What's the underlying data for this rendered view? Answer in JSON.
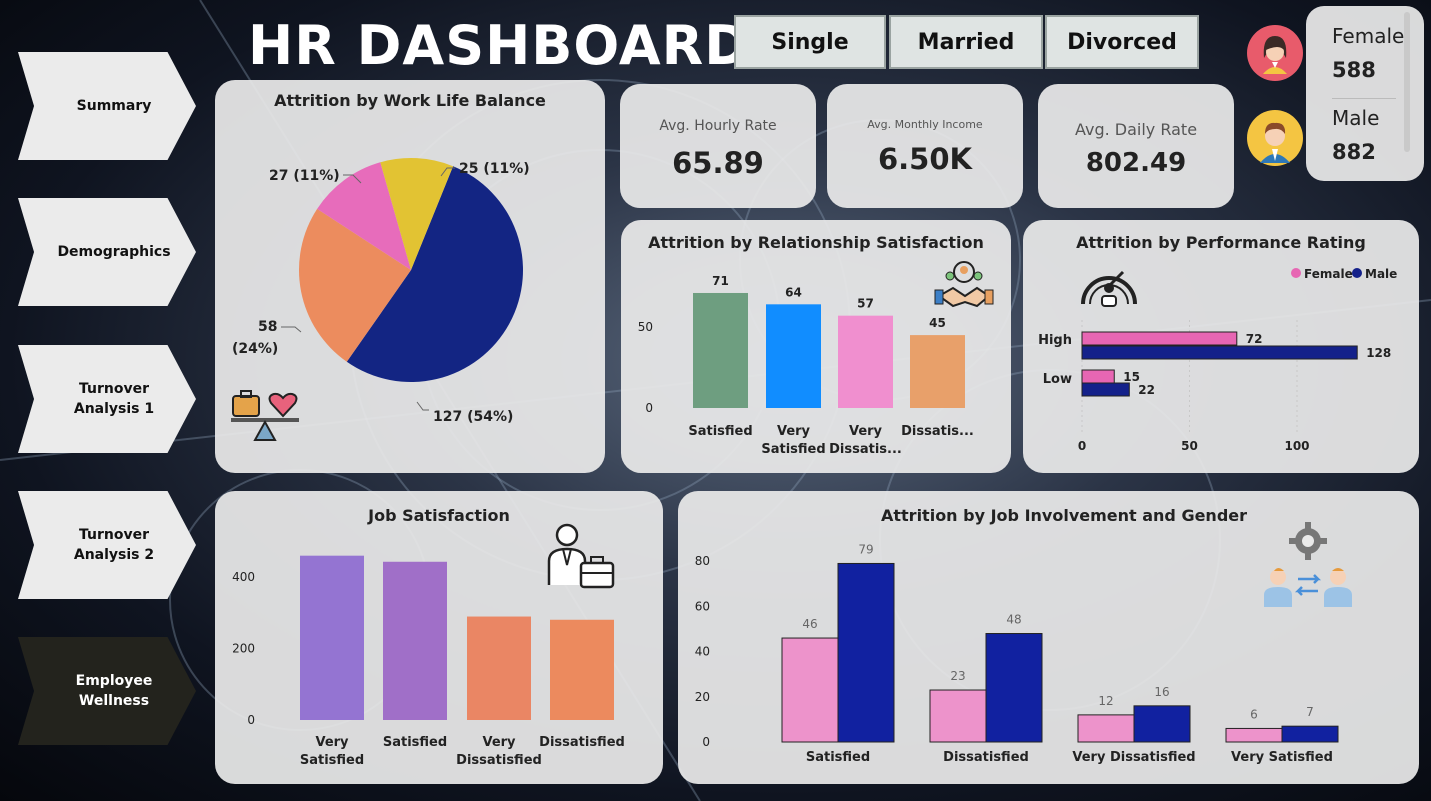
{
  "title": "HR DASHBOARD",
  "nav": [
    {
      "label": "Summary"
    },
    {
      "label": "Demographics"
    },
    {
      "label": "Turnover Analysis 1"
    },
    {
      "label": "Turnover Analysis 2"
    },
    {
      "label": "Employee Wellness"
    }
  ],
  "slicers": [
    "Single",
    "Married",
    "Divorced"
  ],
  "gender": {
    "female_label": "Female",
    "female_value": "588",
    "male_label": "Male",
    "male_value": "882"
  },
  "kpis": {
    "hourly": {
      "label": "Avg. Hourly Rate",
      "value": "65.89"
    },
    "monthly": {
      "label": "Avg. Monthly Income",
      "value": "6.50K"
    },
    "daily": {
      "label": "Avg. Daily Rate",
      "value": "802.49"
    }
  },
  "chart_data": [
    {
      "id": "work_life",
      "type": "pie",
      "title": "Attrition by Work Life Balance",
      "values": [
        127,
        58,
        27,
        25
      ],
      "labels": [
        "127 (54%)",
        "58 (24%)",
        "27 (11%)",
        "25 (11%)"
      ],
      "colors": [
        "#132583",
        "#ec8c5e",
        "#e76cbb",
        "#e2c333"
      ]
    },
    {
      "id": "relationship",
      "type": "bar",
      "title": "Attrition by Relationship Satisfaction",
      "categories": [
        "Satisfied",
        "Very Satisfied",
        "Very Dissatis...",
        "Dissatis..."
      ],
      "values": [
        71,
        64,
        57,
        45
      ],
      "colors": [
        "#6e9e80",
        "#118dff",
        "#f08fcf",
        "#e8a06a"
      ],
      "yticks": [
        0,
        50
      ],
      "ylim": [
        0,
        80
      ]
    },
    {
      "id": "performance",
      "type": "bar",
      "orientation": "horizontal",
      "title": "Attrition by Performance Rating",
      "categories": [
        "High",
        "Low"
      ],
      "series": [
        {
          "name": "Female",
          "values": [
            72,
            15
          ],
          "color": "#e766b3"
        },
        {
          "name": "Male",
          "values": [
            128,
            22
          ],
          "color": "#14218a"
        }
      ],
      "xticks": [
        0,
        50,
        100
      ],
      "xlim": [
        0,
        130
      ],
      "legend": "top-right"
    },
    {
      "id": "job_satisfaction",
      "type": "bar",
      "title": "Job Satisfaction",
      "categories": [
        "Very Satisfied",
        "Satisfied",
        "Very Dissatisfied",
        "Dissatisfied"
      ],
      "values": [
        459,
        442,
        289,
        280
      ],
      "colors": [
        "#9474d2",
        "#a06fc8",
        "#ea8664",
        "#ec8a5e"
      ],
      "yticks": [
        0,
        200,
        400
      ],
      "ylim": [
        0,
        470
      ]
    },
    {
      "id": "job_involvement",
      "type": "bar",
      "title": "Attrition by Job Involvement and Gender",
      "categories": [
        "Satisfied",
        "Dissatisfied",
        "Very Dissatisfied",
        "Very Satisfied"
      ],
      "series": [
        {
          "name": "Female",
          "values": [
            46,
            23,
            12,
            6
          ],
          "color": "#ed93cb"
        },
        {
          "name": "Male",
          "values": [
            79,
            48,
            16,
            7
          ],
          "color": "#1121a0"
        }
      ],
      "yticks": [
        0,
        20,
        40,
        60,
        80
      ],
      "ylim": [
        0,
        80
      ]
    }
  ],
  "icons": {
    "female": "female-avatar-icon",
    "male": "male-avatar-icon",
    "work_life": "work-life-balance-icon",
    "relationship": "handshake-team-icon",
    "performance": "performance-gauge-icon",
    "job_satisfaction": "businessman-briefcase-icon",
    "job_involvement": "employee-exchange-icon"
  }
}
